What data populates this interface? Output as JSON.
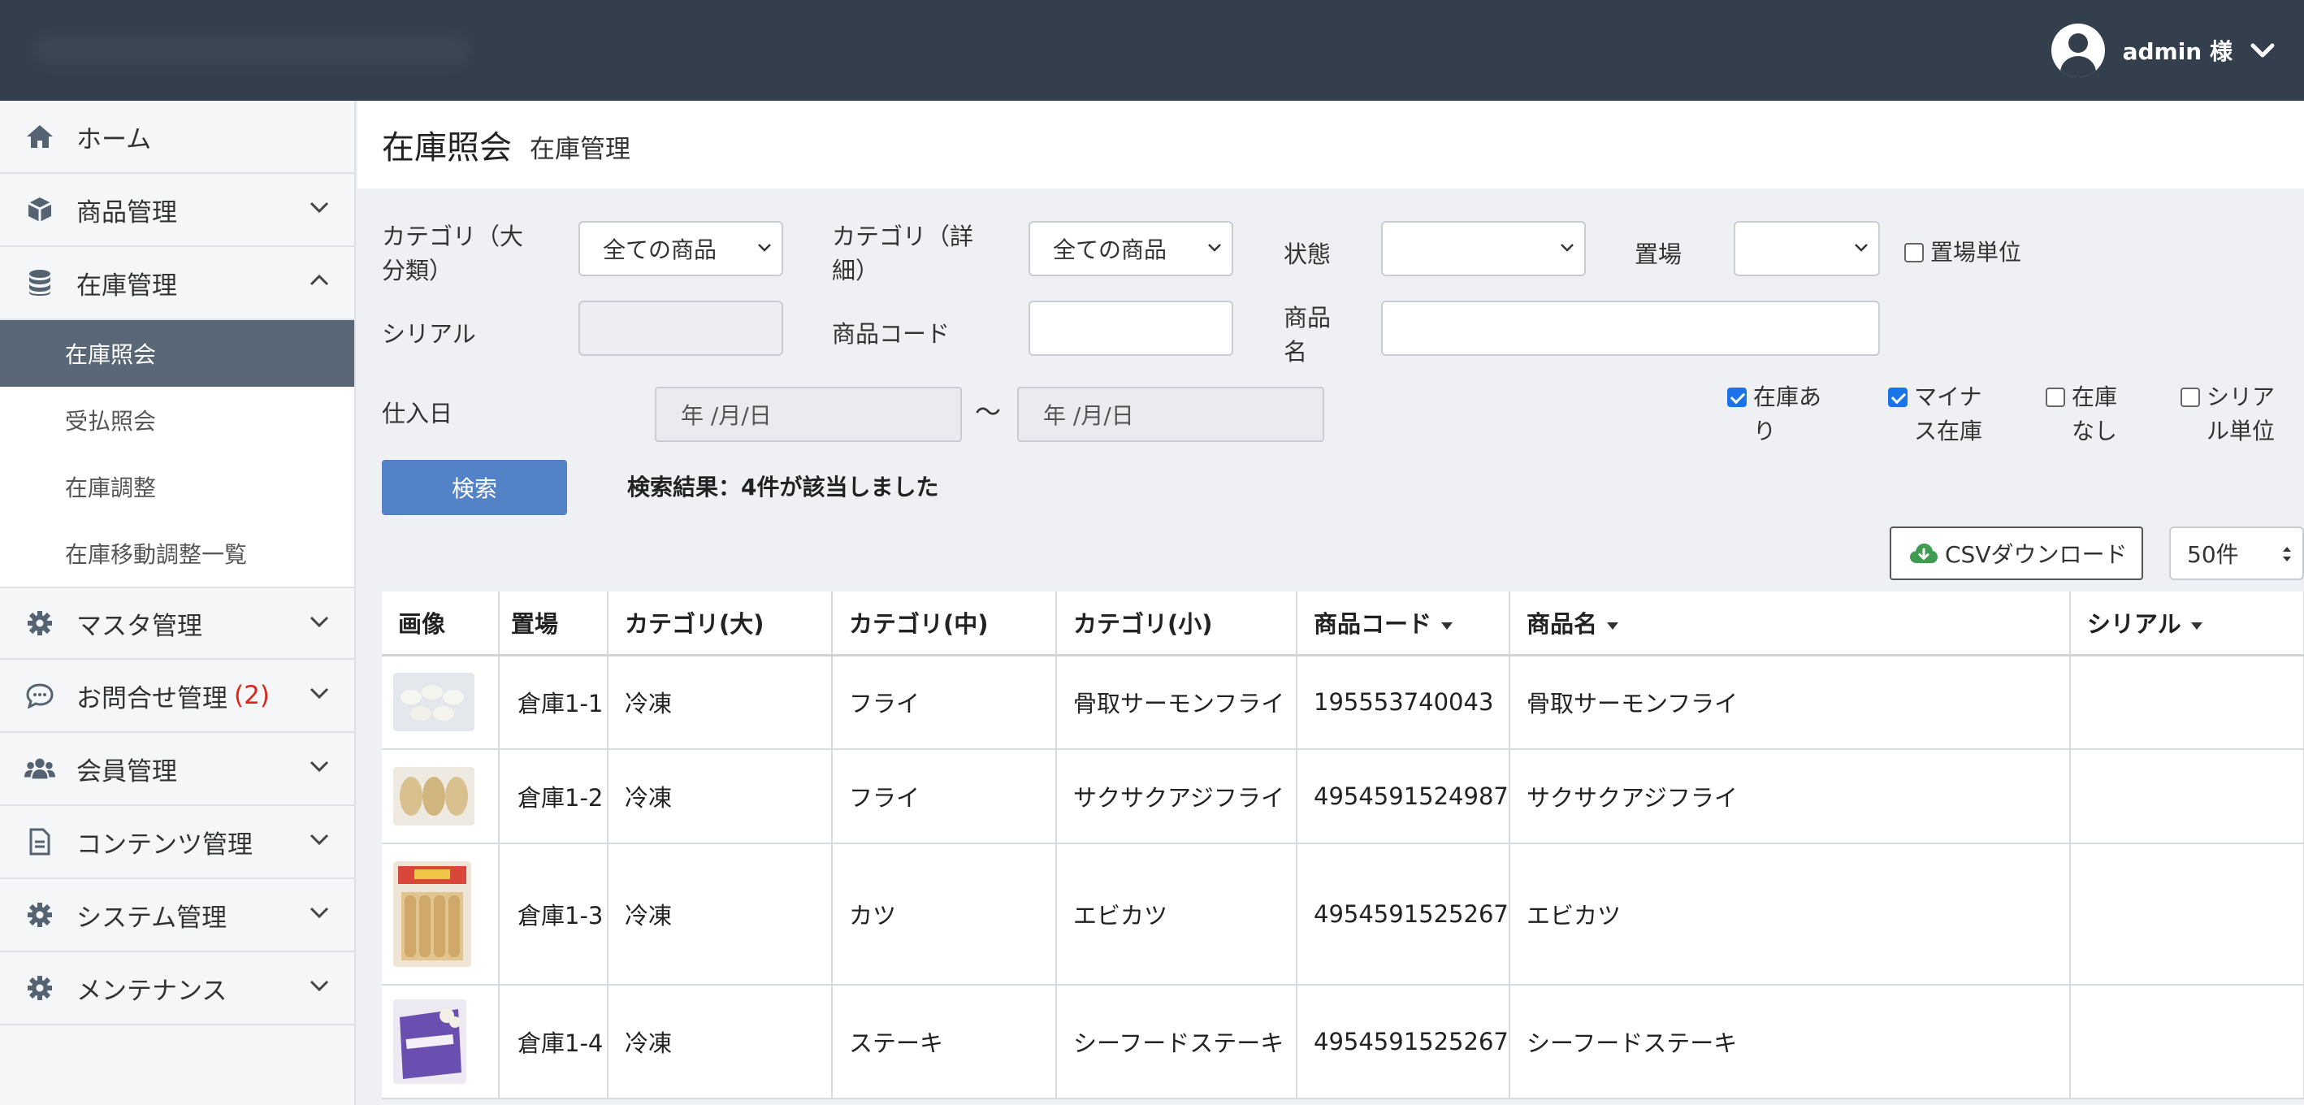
{
  "header": {
    "user_name": "admin 様"
  },
  "sidebar": {
    "items": [
      {
        "label": "ホーム"
      },
      {
        "label": "商品管理"
      },
      {
        "label": "在庫管理"
      },
      {
        "label": "マスタ管理"
      },
      {
        "label": "お問合せ管理",
        "count": "(2)"
      },
      {
        "label": "会員管理"
      },
      {
        "label": "コンテンツ管理"
      },
      {
        "label": "システム管理"
      },
      {
        "label": "メンテナンス"
      }
    ],
    "sub_items": [
      {
        "label": "在庫照会",
        "active": true
      },
      {
        "label": "受払照会"
      },
      {
        "label": "在庫調整"
      },
      {
        "label": "在庫移動調整一覧"
      }
    ]
  },
  "page": {
    "title": "在庫照会",
    "subtitle": "在庫管理"
  },
  "search": {
    "category_major_label_1": "カテゴリ（大",
    "category_major_label_2": "分類）",
    "category_major_value": "全ての商品",
    "category_detail_label_1": "カテゴリ（詳",
    "category_detail_label_2": "細）",
    "category_detail_value": "全ての商品",
    "status_label": "状態",
    "status_value": "",
    "location_label": "置場",
    "location_value": "",
    "location_unit_label": "置場単位",
    "serial_label": "シリアル",
    "serial_value": "",
    "product_code_label": "商品コード",
    "product_code_value": "",
    "product_name_label_1": "商品",
    "product_name_label_2": "名",
    "product_name_value": "",
    "purchase_date_label": "仕入日",
    "date_from_placeholder": "年 /月/日",
    "date_to_placeholder": "年 /月/日",
    "tilde": "〜",
    "filters": [
      {
        "line1": "在庫あ",
        "line2": "り",
        "checked": true
      },
      {
        "line1": "マイナ",
        "line2": "ス在庫",
        "checked": true
      },
      {
        "line1": "在庫",
        "line2": "なし",
        "checked": false
      },
      {
        "line1": "シリア",
        "line2": "ル単位",
        "checked": false
      }
    ],
    "search_button": "検索",
    "result_text": "検索結果：4件が該当しました"
  },
  "toolbar": {
    "csv_label": "CSVダウンロード",
    "per_page": "50件"
  },
  "table": {
    "columns": [
      "画像",
      "置場",
      "カテゴリ(大)",
      "カテゴリ(中)",
      "カテゴリ(小)",
      "商品コード",
      "商品名",
      "シリアル"
    ],
    "rows": [
      {
        "location": "倉庫1-1",
        "cat_major": "冷凍",
        "cat_mid": "フライ",
        "cat_minor": "骨取サーモンフライ",
        "code": "195553740043",
        "name": "骨取サーモンフライ",
        "serial": ""
      },
      {
        "location": "倉庫1-2",
        "cat_major": "冷凍",
        "cat_mid": "フライ",
        "cat_minor": "サクサクアジフライ",
        "code": "4954591524987",
        "name": "サクサクアジフライ",
        "serial": ""
      },
      {
        "location": "倉庫1-3",
        "cat_major": "冷凍",
        "cat_mid": "カツ",
        "cat_minor": "エビカツ",
        "code": "4954591525267",
        "name": "エビカツ",
        "serial": ""
      },
      {
        "location": "倉庫1-4",
        "cat_major": "冷凍",
        "cat_mid": "ステーキ",
        "cat_minor": "シーフードステーキ",
        "code": "4954591525267",
        "name": "シーフードステーキ",
        "serial": ""
      }
    ]
  },
  "colors": {
    "topbar": "#333f4d",
    "accent": "#5482c6",
    "active_nav": "#5a6776",
    "badge": "#d9261c"
  }
}
